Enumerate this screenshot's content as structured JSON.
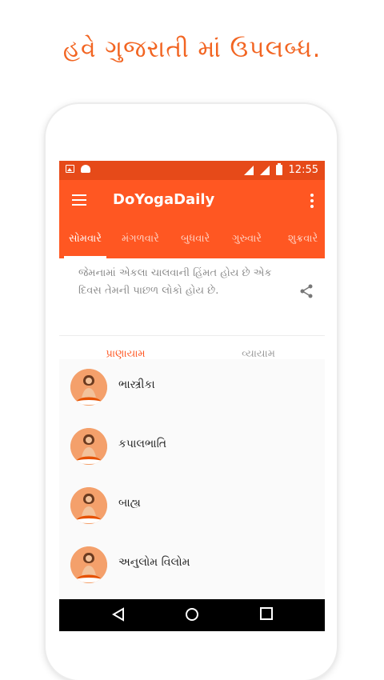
{
  "headline": "હવે ગુજરાતી માં ઉપલબ્ધ.",
  "statusbar": {
    "time": "12:55"
  },
  "appbar": {
    "title": "DoYogaDaily"
  },
  "day_tabs": [
    "સોમવારે",
    "મંગળવારે",
    "બુધવારે",
    "ગુરુવારે",
    "શુક્રવારે"
  ],
  "active_day": "સોમવારે",
  "quote": {
    "text": "જેમનામાં એકલા ચાલવાની હિંમત હોય છે એક દિવસ તેમની પાછળ લોકો હોય છે."
  },
  "sub_tabs": [
    "પ્રાણાયામ",
    "વ્યાયામ"
  ],
  "active_sub_tab": "પ્રાણાયામ",
  "items": [
    {
      "label": "ભાસ્ત્રીકા",
      "icon": "yoga-pose-icon"
    },
    {
      "label": "કપાલભાતિ",
      "icon": "yoga-pose-icon"
    },
    {
      "label": "બાહ્ય",
      "icon": "yoga-pose-icon"
    },
    {
      "label": "અનુલોમ વિલોમ",
      "icon": "yoga-pose-icon"
    }
  ],
  "colors": {
    "primary": "#ff5722",
    "primary_dark": "#e64a19",
    "headline": "#f26522"
  }
}
